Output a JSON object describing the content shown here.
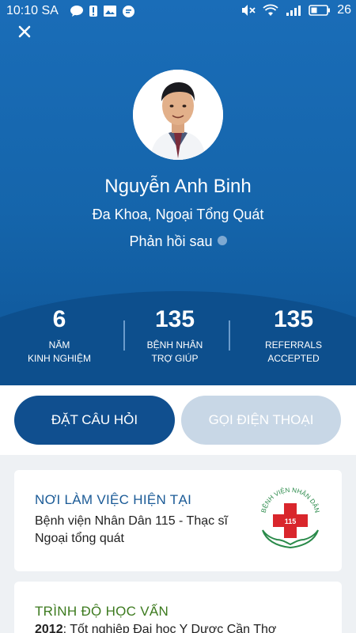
{
  "status_bar": {
    "time": "10:10 SA",
    "battery": "26",
    "left_icons": [
      "chat-bubble-icon",
      "alert-icon",
      "image-icon",
      "message-icon"
    ],
    "right_icons": [
      "mute-icon",
      "wifi-icon",
      "signal-icon",
      "battery-icon"
    ]
  },
  "doctor": {
    "name": "Nguyễn Anh Binh",
    "specialty": "Đa Khoa, Ngoại Tổng Quát",
    "response": "Phản hồi sau"
  },
  "stats": [
    {
      "value": "6",
      "label_line1": "NĂM",
      "label_line2": "KINH NGHIỆM"
    },
    {
      "value": "135",
      "label_line1": "BỆNH NHÂN",
      "label_line2": "TRỢ GIÚP"
    },
    {
      "value": "135",
      "label_line1": "REFERRALS",
      "label_line2": "ACCEPTED"
    }
  ],
  "actions": {
    "ask": "ĐẶT CÂU HỎI",
    "call": "GỌI ĐIỆN THOẠI"
  },
  "workplace": {
    "title": "NƠI LÀM VIỆC HIỆN TẠI",
    "text": "Bệnh viện Nhân Dân 115 - Thạc sĩ Ngoại tổng quát",
    "logo_text": "BỆNH VIỆN NHÂN DÂN",
    "logo_number": "115"
  },
  "education": {
    "title": "TRÌNH ĐỘ HỌC VẤN",
    "year": "2012",
    "text": ": Tốt nghiệp Đại học Y Dược Cần Thơ"
  },
  "colors": {
    "hero": "#1565ab",
    "primary_button": "#104f8f",
    "disabled_button": "#c8d7e6",
    "card_title_blue": "#1a5a96",
    "card_title_green": "#3c7a1e"
  }
}
